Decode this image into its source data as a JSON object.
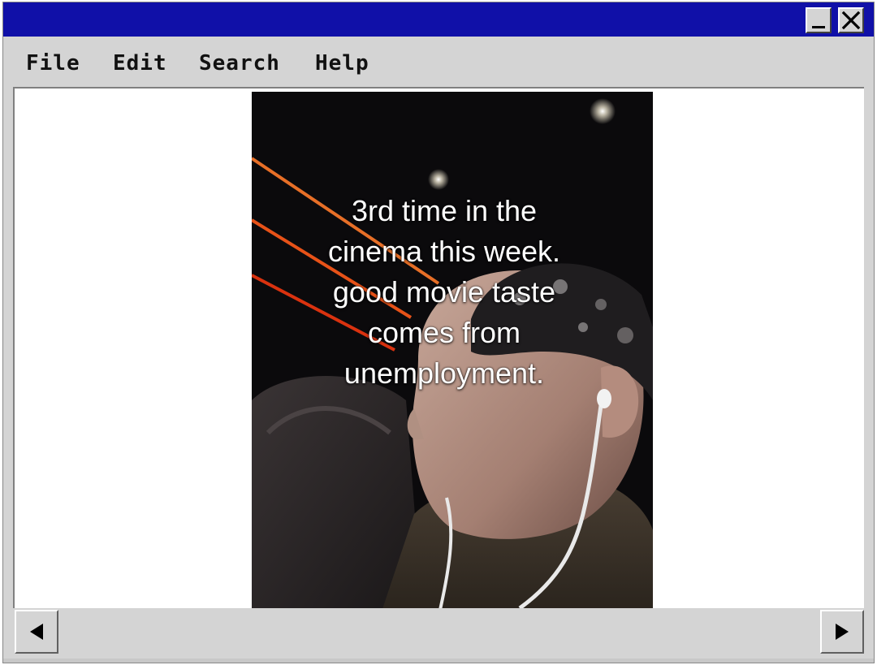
{
  "window": {
    "titlebar_color": "#1010a8",
    "minimize_icon": "minimize-icon",
    "close_icon": "close-icon"
  },
  "menu": {
    "items": [
      {
        "label": "File"
      },
      {
        "label": "Edit"
      },
      {
        "label": "Search"
      },
      {
        "label": "Help"
      }
    ]
  },
  "video": {
    "caption_lines": [
      "3rd time in the",
      "cinema this week.",
      "good movie taste",
      "comes from",
      "unemployment."
    ]
  },
  "scrollbar": {
    "left_icon": "arrow-left-icon",
    "right_icon": "arrow-right-icon"
  }
}
